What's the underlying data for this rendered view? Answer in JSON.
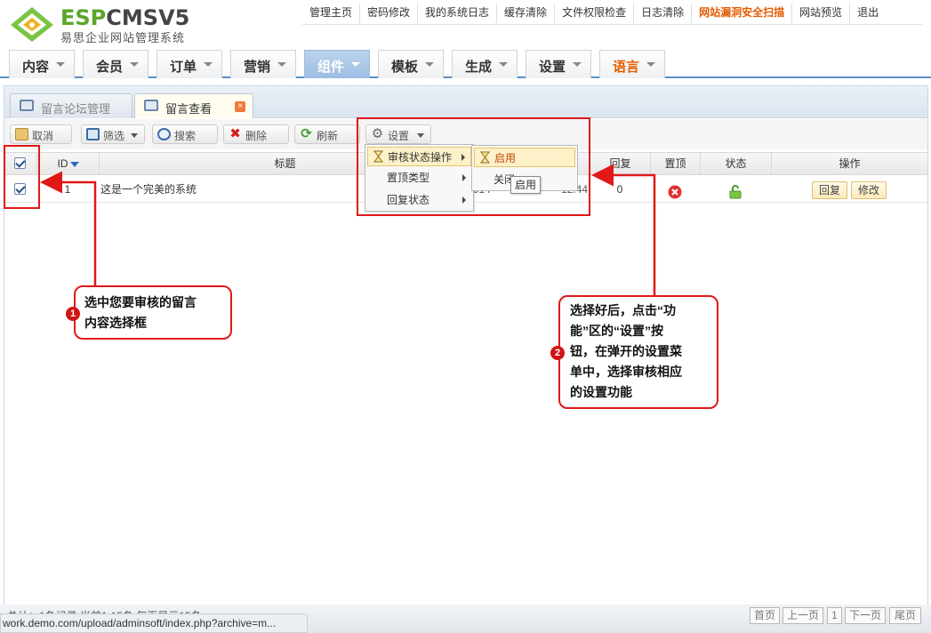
{
  "brand": {
    "logo_text_green": "ESP",
    "logo_text_dark": "CMS",
    "logo_version": "V5",
    "subtitle": "易思企业网站管理系统"
  },
  "topnav": [
    {
      "label": "管理主页"
    },
    {
      "label": "密码修改"
    },
    {
      "label": "我的系统日志"
    },
    {
      "label": "缓存清除"
    },
    {
      "label": "文件权限检查"
    },
    {
      "label": "日志清除"
    },
    {
      "label": "网站漏洞安全扫描"
    },
    {
      "label": "网站预览"
    },
    {
      "label": "退出"
    }
  ],
  "mainnav": [
    {
      "label": "内容"
    },
    {
      "label": "会员"
    },
    {
      "label": "订单"
    },
    {
      "label": "营销"
    },
    {
      "label": "组件"
    },
    {
      "label": "模板"
    },
    {
      "label": "生成"
    },
    {
      "label": "设置"
    },
    {
      "label": "语言"
    }
  ],
  "work_tabs": [
    {
      "label": "留言论坛管理"
    },
    {
      "label": "留言查看"
    }
  ],
  "toolbar": {
    "cancel": "取消",
    "filter": "筛选",
    "search": "搜索",
    "delete": "删除",
    "refresh": "刷新",
    "settings": "设置"
  },
  "table": {
    "headers": {
      "id": "ID",
      "title": "标题",
      "reply": "回复",
      "top": "置顶",
      "status": "状态",
      "actions": "操作"
    },
    "rows": [
      {
        "id": "1",
        "title": "这是一个完美的系统",
        "date_fragment": "2014",
        "date_tail": "12:44",
        "reply": "0",
        "btn_reply": "回复",
        "btn_edit": "修改"
      }
    ]
  },
  "settings_menu": {
    "items": [
      "审核状态操作",
      "置顶类型",
      "回复状态"
    ],
    "submenu": [
      "启用",
      "关闭"
    ],
    "tooltip": "启用"
  },
  "annotations": {
    "callout1": [
      "选中您要审核的留言",
      "内容选择框"
    ],
    "callout2": [
      "选择好后，点击“功",
      "能”区的“设置”按",
      "钮，在弹开的设置菜",
      "单中，选择审核相应",
      "的设置功能"
    ],
    "num1": "1",
    "num2": "2"
  },
  "footer": {
    "info": "总计：1条记录 当前1-15条 每页显示15条",
    "status_url": "work.demo.com/upload/adminsoft/index.php?archive=m...",
    "pager": [
      "首页",
      "上一页",
      "1",
      "下一页",
      "尾页"
    ]
  },
  "colors": {
    "accent_blue": "#5b8ec7",
    "annotation_red": "#e01818",
    "hot_orange": "#e35d00",
    "brand_green": "#5aa52a"
  }
}
